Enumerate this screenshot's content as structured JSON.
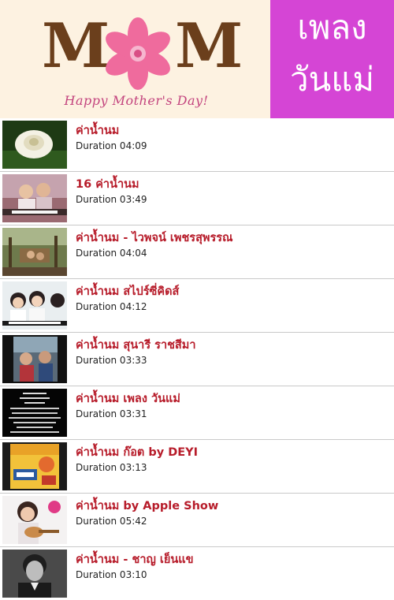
{
  "banner": {
    "mom_letter_1": "M",
    "mom_letter_2": "M",
    "tagline": "Happy Mother's Day!",
    "title_line1": "เพลง",
    "title_line2": "วันแม่",
    "colors": {
      "left_bg": "#fdf2e1",
      "right_bg": "#d545d5",
      "mom": "#6b3f1c",
      "flower": "#ef6b9d"
    }
  },
  "songs": [
    {
      "title": "ค่าน้ำนม",
      "duration": "Duration 04:09",
      "thumbnail": "white-flower-thumbnail"
    },
    {
      "title": "16 ค่าน้ำนม",
      "duration": "Duration 03:49",
      "thumbnail": "mother-daughter-thumbnail"
    },
    {
      "title": "ค่าน้ำนม - ไวพจน์ เพชรสุพรรณ",
      "duration": "Duration 04:04",
      "thumbnail": "village-scene-thumbnail"
    },
    {
      "title": "ค่าน้ำนม สไปร์ซี่คิดส์",
      "duration": "Duration 04:12",
      "thumbnail": "kids-singing-thumbnail"
    },
    {
      "title": "ค่าน้ำนม สุนารี  ราชสีมา",
      "duration": "Duration 03:33",
      "thumbnail": "family-photo-thumbnail"
    },
    {
      "title": "ค่าน้ำนม เพลง วันแม่",
      "duration": "Duration 03:31",
      "thumbnail": "lyrics-screen-thumbnail"
    },
    {
      "title": "ค่าน้ำนม ก๊อต by DEYI",
      "duration": "Duration 03:13",
      "thumbnail": "album-cover-thumbnail"
    },
    {
      "title": "ค่าน้ำนม by Apple Show",
      "duration": "Duration 05:42",
      "thumbnail": "ukulele-singer-thumbnail"
    },
    {
      "title": "ค่าน้ำนม - ชาญ เย็นแข",
      "duration": "Duration 03:10",
      "thumbnail": "vintage-portrait-thumbnail"
    }
  ]
}
